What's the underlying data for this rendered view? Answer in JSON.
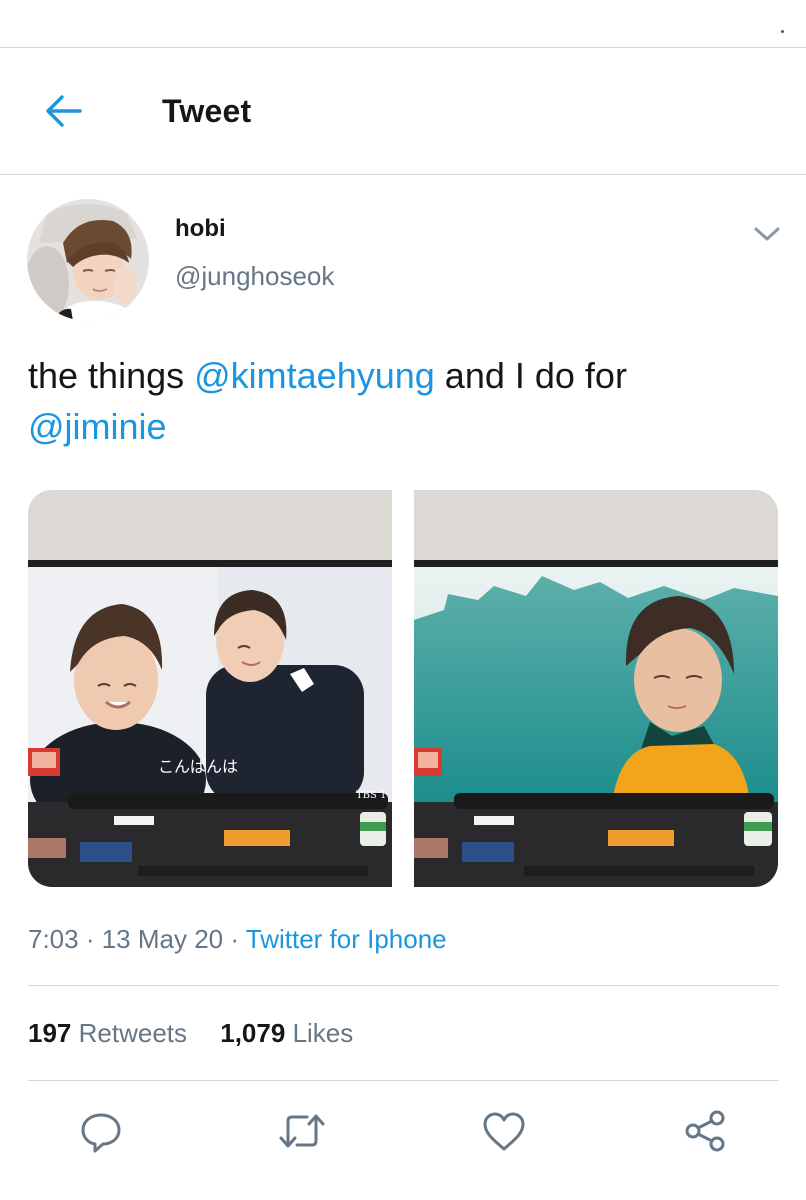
{
  "header": {
    "title": "Tweet",
    "back_icon": "arrow-left-icon"
  },
  "tweet": {
    "author": {
      "name": "hobi",
      "handle": "@junghoseok"
    },
    "text": {
      "before": "the things ",
      "mention_1": "@kimtaehyung",
      "middle": " and I do for",
      "mention_2": "@jiminie"
    },
    "media": {
      "left_caption": "こんばんは",
      "left_logo": "TBS 1"
    },
    "meta": {
      "time": "7:03",
      "sep1": " · ",
      "date": "13 May 20",
      "sep2": " · ",
      "source": "Twitter for Iphone"
    },
    "stats": {
      "retweets_count": "197",
      "retweets_label": "Retweets",
      "likes_count": "1,079",
      "likes_label": "Likes"
    }
  },
  "colors": {
    "accent": "#1b95e0",
    "secondary_text": "#657786",
    "divider": "#cfd9de"
  }
}
